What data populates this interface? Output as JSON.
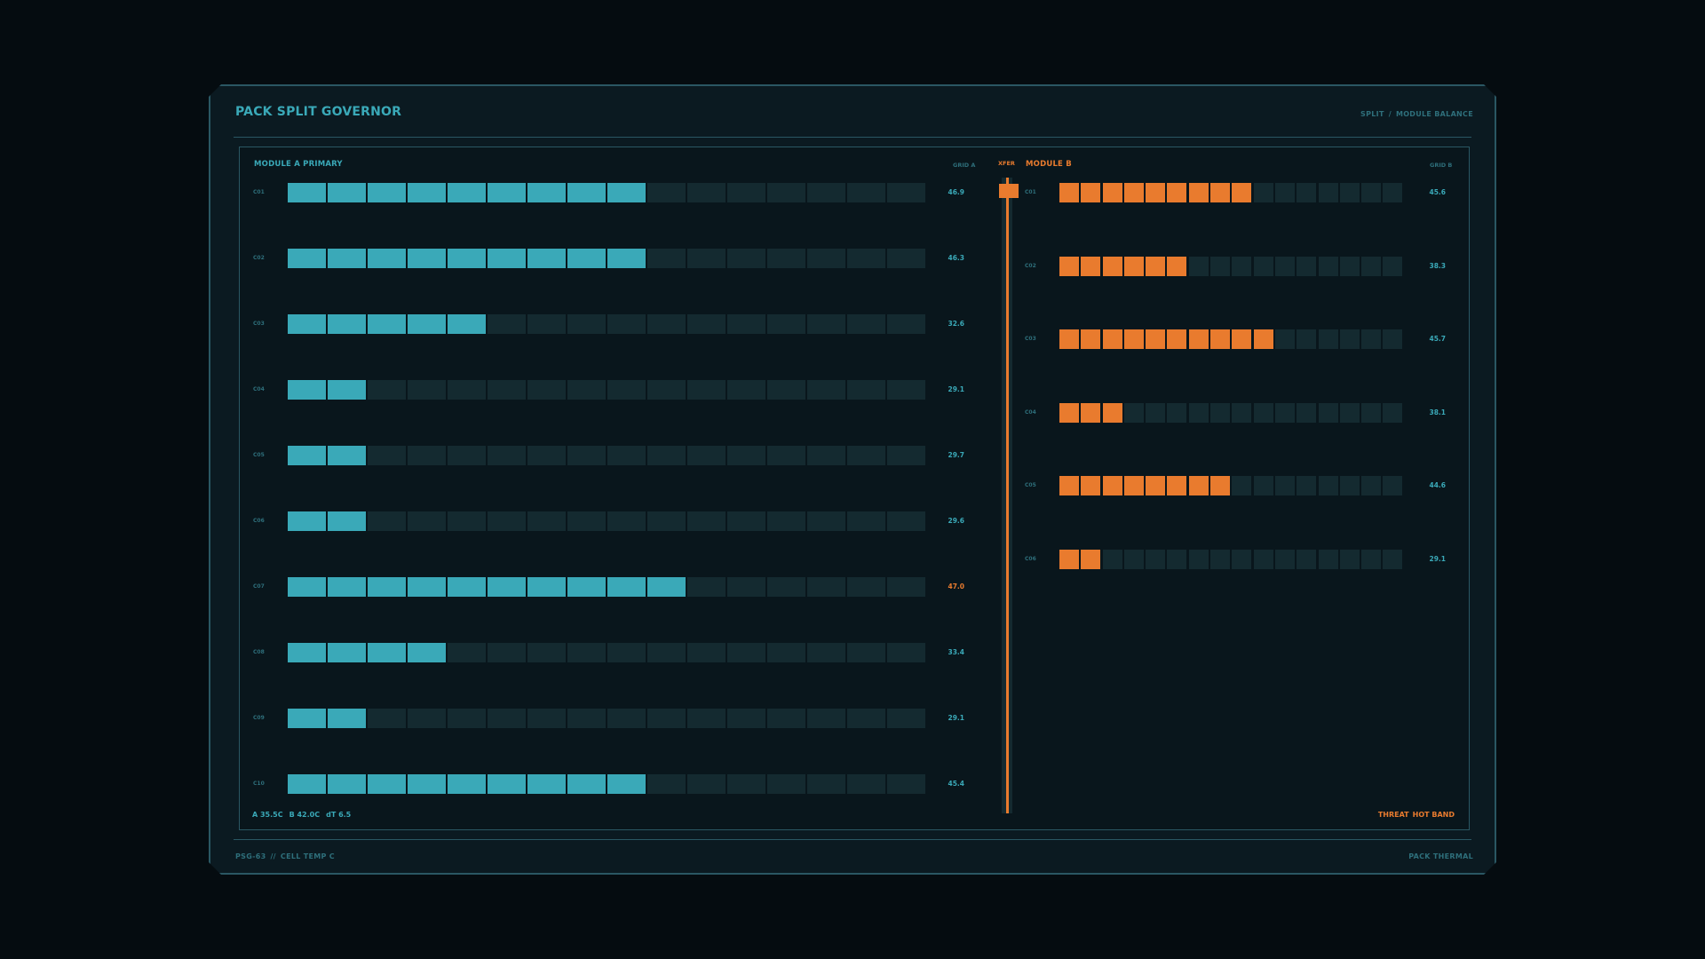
{
  "frame": {
    "title": "PACK SPLIT GOVERNOR",
    "crumb_1": "SPLIT",
    "crumb_sep": "/",
    "crumb_2": "MODULE BALANCE",
    "footer_left_1": "PSG-63",
    "footer_left_sep": "//",
    "footer_left_2": "CELL TEMP C",
    "footer_right": "PACK THERMAL"
  },
  "module_a": {
    "title": "MODULE A  PRIMARY",
    "grid_label": "GRID A",
    "segments_total": 16,
    "rows": [
      {
        "label": "C01",
        "filled": 9,
        "value": "46.9",
        "hot": false
      },
      {
        "label": "C02",
        "filled": 9,
        "value": "46.3",
        "hot": false
      },
      {
        "label": "C03",
        "filled": 5,
        "value": "32.6",
        "hot": false
      },
      {
        "label": "C04",
        "filled": 2,
        "value": "29.1",
        "hot": false
      },
      {
        "label": "C05",
        "filled": 2,
        "value": "29.7",
        "hot": false
      },
      {
        "label": "C06",
        "filled": 2,
        "value": "29.6",
        "hot": false
      },
      {
        "label": "C07",
        "filled": 10,
        "value": "47.0",
        "hot": true
      },
      {
        "label": "C08",
        "filled": 4,
        "value": "33.4",
        "hot": false
      },
      {
        "label": "C09",
        "filled": 2,
        "value": "29.1",
        "hot": false
      },
      {
        "label": "C10",
        "filled": 9,
        "value": "45.4",
        "hot": false
      }
    ]
  },
  "module_b": {
    "title": "MODULE B",
    "grid_label": "GRID B",
    "segments_total": 16,
    "rows": [
      {
        "label": "C01",
        "filled": 9,
        "value": "45.6"
      },
      {
        "label": "C02",
        "filled": 6,
        "value": "38.3"
      },
      {
        "label": "C03",
        "filled": 10,
        "value": "45.7"
      },
      {
        "label": "C04",
        "filled": 3,
        "value": "38.1"
      },
      {
        "label": "C05",
        "filled": 8,
        "value": "44.6"
      },
      {
        "label": "C06",
        "filled": 2,
        "value": "29.1"
      }
    ]
  },
  "xfer": {
    "label": "XFER"
  },
  "status": {
    "a": "A 35.5C",
    "b": "B 42.0C",
    "dt": "dT 6.5",
    "threat_label": "THREAT",
    "threat_value": "HOT BAND"
  },
  "colors": {
    "teal": "#3aa9b8",
    "orange": "#e97b2e",
    "empty_segment": "#142a30",
    "background": "#050c10"
  }
}
